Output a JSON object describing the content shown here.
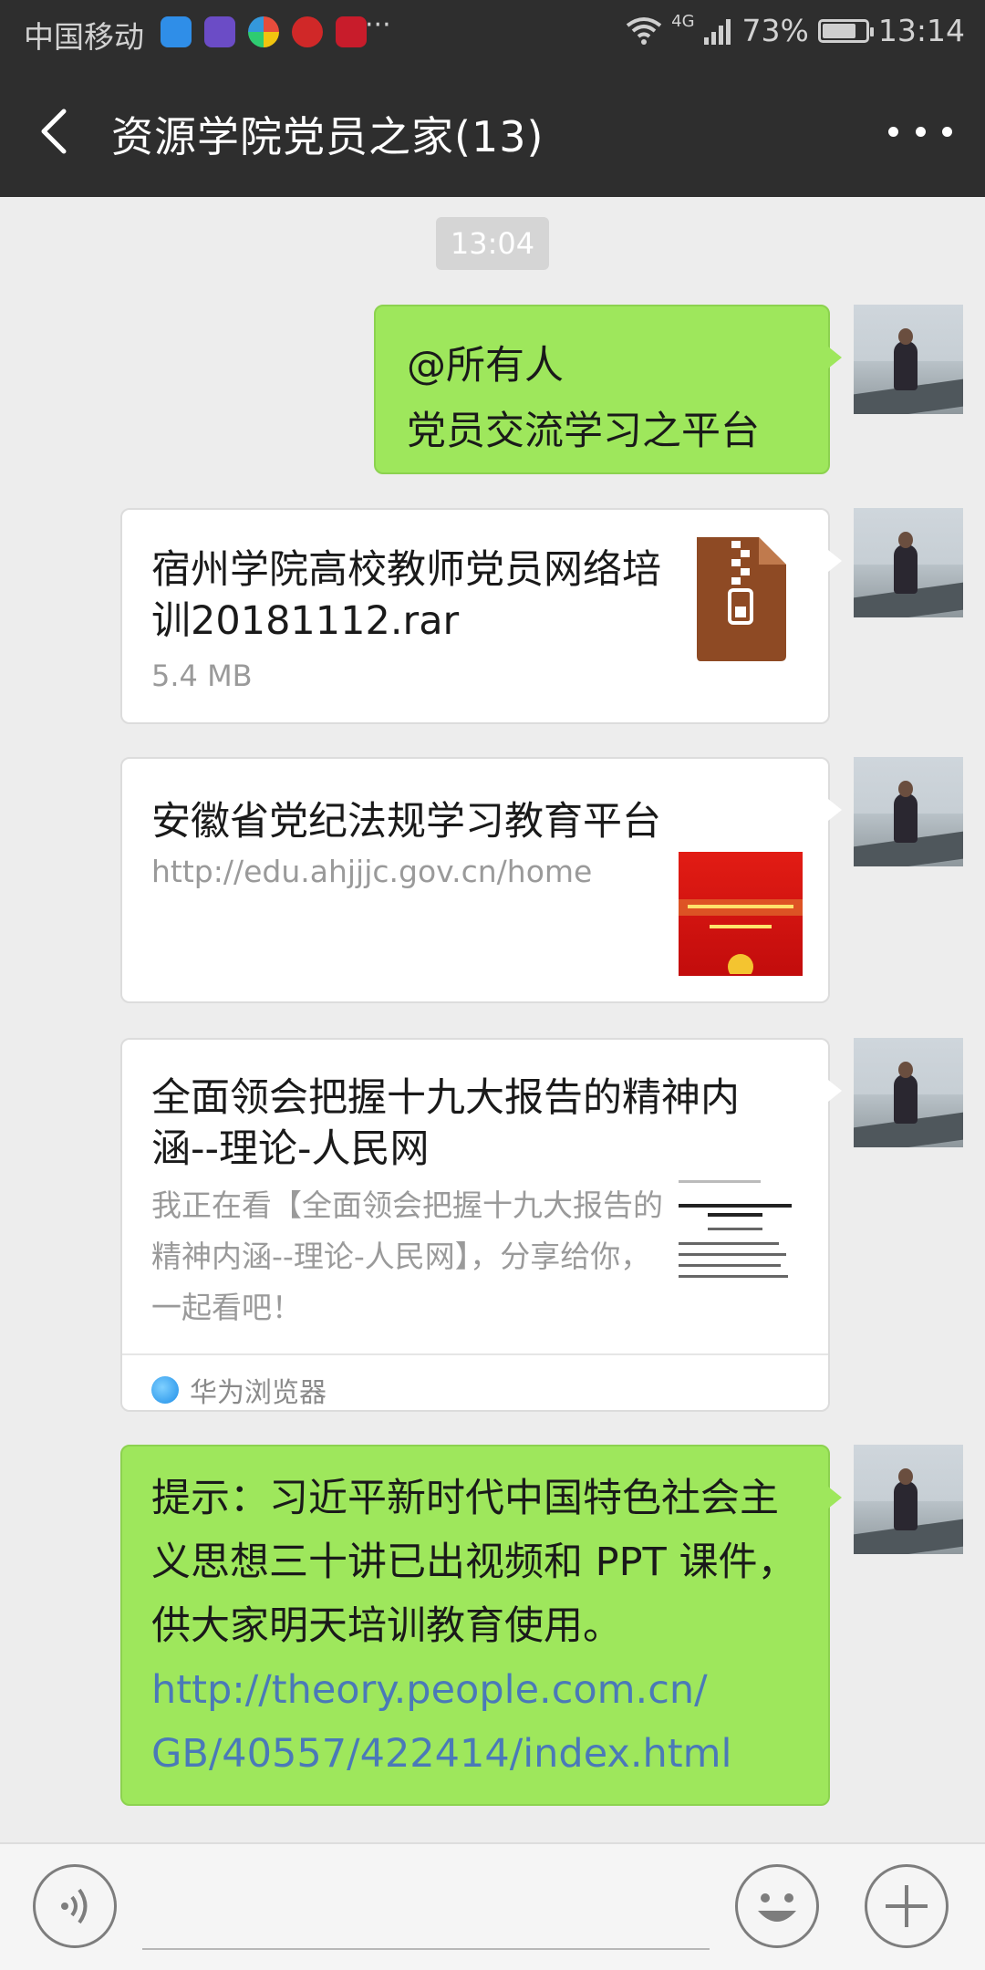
{
  "status_bar": {
    "carrier": "中国移动",
    "network": "4G",
    "battery": "73%",
    "time": "13:14",
    "more": "···",
    "icons": [
      "qq-icon",
      "video-icon",
      "browser-icon",
      "weibo-icon",
      "huawei-icon",
      "wifi-icon",
      "signal-icon",
      "battery-icon"
    ]
  },
  "header": {
    "title": "资源学院党员之家(13)"
  },
  "timestamp": "13:04",
  "messages": [
    {
      "type": "text",
      "line1": "@所有人",
      "line2": "党员交流学习之平台"
    },
    {
      "type": "file",
      "name": "宿州学院高校教师党员网络培训20181112.rar",
      "size": "5.4 MB"
    },
    {
      "type": "link",
      "title": "安徽省党纪法规学习教育平台",
      "url": "http://edu.ahjjjc.gov.cn/home"
    },
    {
      "type": "link",
      "title": "全面领会把握十九大报告的精神内涵--理论-人民网",
      "desc": "我正在看【全面领会把握十九大报告的精神内涵--理论-人民网】，分享给你，一起看吧！",
      "source": "华为浏览器"
    },
    {
      "type": "text",
      "text": "提示：习近平新时代中国特色社会主义思想三十讲已出视频和 PPT 课件，供大家明天培训教育使用。",
      "link1": "http://theory.people.com.cn/",
      "link2": "GB/40557/422414/index.html"
    }
  ],
  "colors": {
    "bar_bg": "#2e2e2e",
    "chat_bg": "#ededed",
    "bubble_green": "#9ee75c",
    "link": "#4a79b8"
  }
}
